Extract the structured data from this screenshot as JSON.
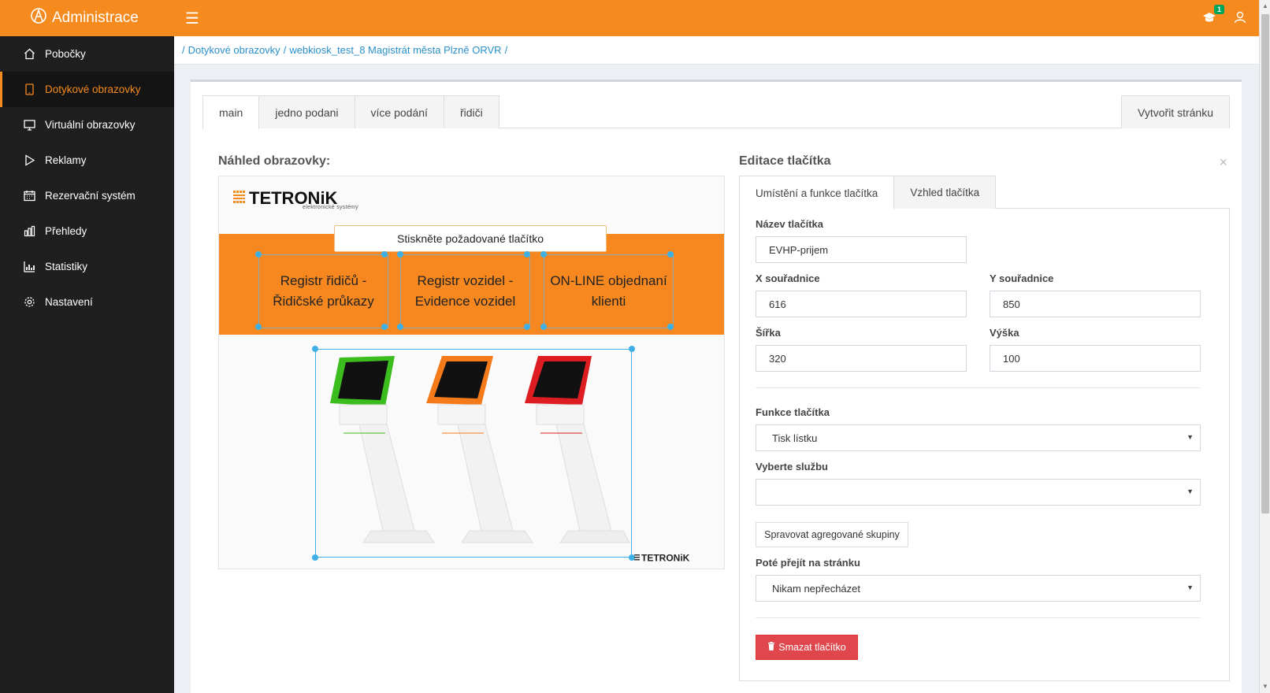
{
  "app": {
    "title": "Administrace",
    "badge_count": "1"
  },
  "sidebar": {
    "items": [
      {
        "label": "Pobočky",
        "icon": "home-icon"
      },
      {
        "label": "Dotykové obrazovky",
        "icon": "tablet-icon",
        "active": true
      },
      {
        "label": "Virtuální obrazovky",
        "icon": "monitor-icon"
      },
      {
        "label": "Reklamy",
        "icon": "play-icon"
      },
      {
        "label": "Rezervační systém",
        "icon": "calendar-icon"
      },
      {
        "label": "Přehledy",
        "icon": "bar-chart-icon"
      },
      {
        "label": "Statistiky",
        "icon": "stats-icon"
      },
      {
        "label": "Nastavení",
        "icon": "gear-icon"
      }
    ]
  },
  "breadcrumb": {
    "sep": "/",
    "items": [
      "Dotykové obrazovky",
      "webkiosk_test_8 Magistrát města Plzně ORVR"
    ]
  },
  "tabs": {
    "items": [
      "main",
      "jedno podani",
      "více podání",
      "řidiči"
    ],
    "create_label": "Vytvořit stránku"
  },
  "preview": {
    "title": "Náhled obrazovky:",
    "logo_text": "TETRONiK",
    "logo_sub": "elektronické systémy",
    "prompt": "Stiskněte požadované tlačítko",
    "buttons": [
      {
        "line1": "Registr řidičů -",
        "line2": "Řidičské průkazy"
      },
      {
        "line1": "Registr vozidel -",
        "line2": "Evidence vozidel"
      },
      {
        "line1": "ON-LINE objednaní",
        "line2": "klienti"
      }
    ],
    "footer_logo": "TETRONiK",
    "colors": {
      "band": "#f7881f",
      "kiosk1": "#3bbd1e",
      "kiosk2": "#f57a1a",
      "kiosk3": "#dd1d22"
    }
  },
  "editor": {
    "title": "Editace tlačítka",
    "close": "×",
    "tabs": [
      "Umístění a funkce tlačítka",
      "Vzhled tlačítka"
    ],
    "name_label": "Název tlačítka",
    "name_value": "EVHP-prijem",
    "x_label": "X souřadnice",
    "x_value": "616",
    "y_label": "Y souřadnice",
    "y_value": "850",
    "w_label": "Šířka",
    "w_value": "320",
    "h_label": "Výška",
    "h_value": "100",
    "function_label": "Funkce tlačítka",
    "function_value": "Tisk lístku",
    "service_label": "Vyberte službu",
    "service_value": "",
    "manage_groups_label": "Spravovat agregované skupiny",
    "next_page_label": "Poté přejít na stránku",
    "next_page_value": "Nikam nepřecházet",
    "delete_label": "Smazat tlačítko"
  },
  "theme": {
    "accent": "#f58a1f",
    "sidebar_bg": "#1f1f1f",
    "link": "#2a8fcb",
    "danger": "#e0474c"
  }
}
